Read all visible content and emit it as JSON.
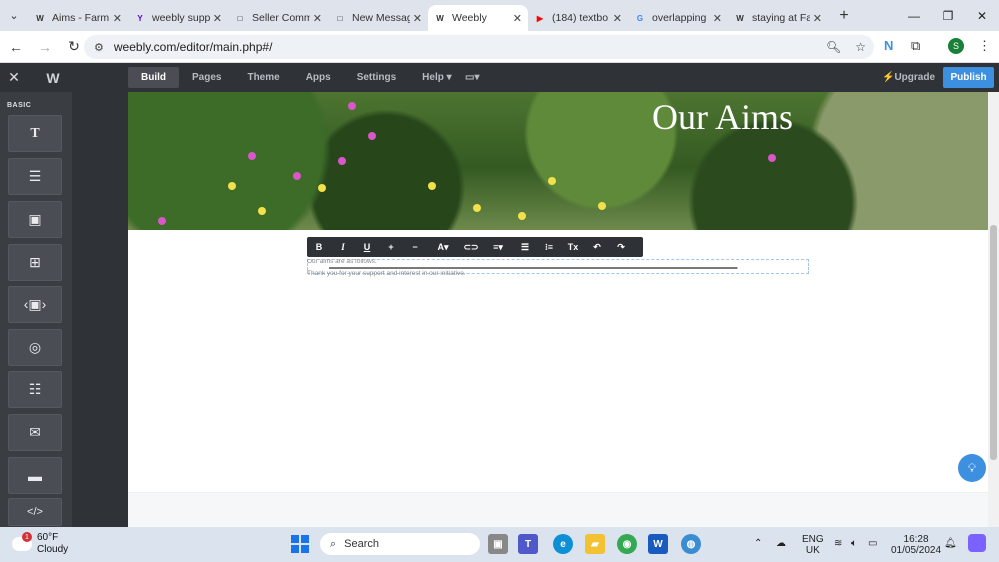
{
  "browser": {
    "tabs": [
      {
        "title": "Aims - Farm",
        "icon": "weebly-icon",
        "fav_color": "#333333",
        "fav_char": "W"
      },
      {
        "title": "weebly supp",
        "icon": "yahoo-icon",
        "fav_color": "#6001d2",
        "fav_char": "Y"
      },
      {
        "title": "Seller Comm",
        "icon": "seller-icon",
        "fav_color": "#111111",
        "fav_char": "□"
      },
      {
        "title": "New Messag",
        "icon": "message-icon",
        "fav_color": "#111111",
        "fav_char": "□"
      },
      {
        "title": "Weebly",
        "icon": "weebly-icon",
        "fav_color": "#333333",
        "fav_char": "W",
        "active": true
      },
      {
        "title": "(184) textbo",
        "icon": "youtube-icon",
        "fav_color": "#ff0000",
        "fav_char": "▶"
      },
      {
        "title": "overlapping",
        "icon": "google-icon",
        "fav_color": "#4285f4",
        "fav_char": "G"
      },
      {
        "title": "staying at Fa",
        "icon": "weebly-icon",
        "fav_color": "#333333",
        "fav_char": "W"
      }
    ],
    "url": "weebly.com/editor/main.php#/"
  },
  "editor": {
    "tabs": [
      "Build",
      "Pages",
      "Theme",
      "Apps",
      "Settings",
      "Help ▾"
    ],
    "active_tab": "Build",
    "upgrade_label": "⚡Upgrade",
    "publish_label": "Publish",
    "sidebar_section": "BASIC"
  },
  "page": {
    "hero_title": "Our Aims",
    "text_lines": [
      "Our aims are as follows:",
      "Thank you for your support and interest in our initiative."
    ]
  },
  "taskbar": {
    "weather_temp": "60°F",
    "weather_desc": "Cloudy",
    "weather_badge": "1",
    "search_placeholder": "Search",
    "lang": "ENG",
    "region": "UK",
    "time": "16:28",
    "date": "01/05/2024"
  },
  "colors": {
    "accent": "#3d8fe0",
    "editor_bar": "#2f3237",
    "sidebar": "#3a3d42"
  }
}
